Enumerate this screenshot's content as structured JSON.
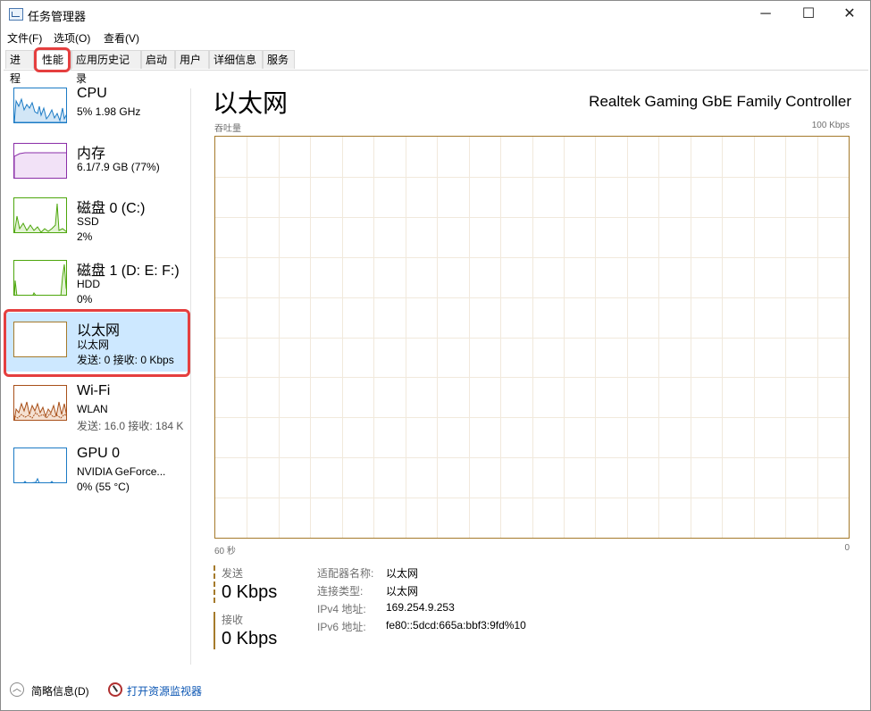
{
  "window": {
    "title": "任务管理器",
    "controls": {
      "minimize": "─",
      "maximize": "☐",
      "close": "✕"
    }
  },
  "menu": [
    "文件(F)",
    "选项(O)",
    "查看(V)"
  ],
  "tabs": [
    "进程",
    "性能",
    "应用历史记录",
    "启动",
    "用户",
    "详细信息",
    "服务"
  ],
  "active_tab": "性能",
  "sidebar": {
    "items": [
      {
        "title": "CPU",
        "sub1": "5% 1.98 GHz",
        "sub2": "",
        "color": "#1c7bc5"
      },
      {
        "title": "内存",
        "sub1": "6.1/7.9 GB (77%)",
        "sub2": "",
        "color": "#8b2fa8"
      },
      {
        "title": "磁盘 0 (C:)",
        "sub1": "SSD",
        "sub2": "2%",
        "color": "#4da60c"
      },
      {
        "title": "磁盘 1 (D: E: F:)",
        "sub1": "HDD",
        "sub2": "0%",
        "color": "#4da60c"
      },
      {
        "title": "以太网",
        "sub1": "以太网",
        "sub2": "发送: 0 接收: 0 Kbps",
        "color": "#a57a2b"
      },
      {
        "title": "Wi-Fi",
        "sub1": "WLAN",
        "sub2": "发送: 16.0 接收: 184 K",
        "color": "#a8501a"
      },
      {
        "title": "GPU 0",
        "sub1": "NVIDIA GeForce...",
        "sub2": "0% (55 °C)",
        "color": "#1c7bc5"
      }
    ],
    "selected_index": 4
  },
  "main": {
    "title": "以太网",
    "device": "Realtek Gaming GbE Family Controller",
    "graph_label": "吞吐量",
    "graph_max": "100 Kbps",
    "x_left": "60 秒",
    "x_right": "0",
    "send_label": "发送",
    "send_value": "0 Kbps",
    "recv_label": "接收",
    "recv_value": "0 Kbps",
    "details": [
      {
        "label": "适配器名称:",
        "value": "以太网"
      },
      {
        "label": "连接类型:",
        "value": "以太网"
      },
      {
        "label": "IPv4 地址:",
        "value": "169.254.9.253"
      },
      {
        "label": "IPv6 地址:",
        "value": "fe80::5dcd:665a:bbf3:9fd%10"
      }
    ]
  },
  "footer": {
    "summary": "简略信息(D)",
    "open_monitor": "打开资源监视器"
  },
  "accent_color": "#a57a2b",
  "highlight_color": "#e53f3f"
}
